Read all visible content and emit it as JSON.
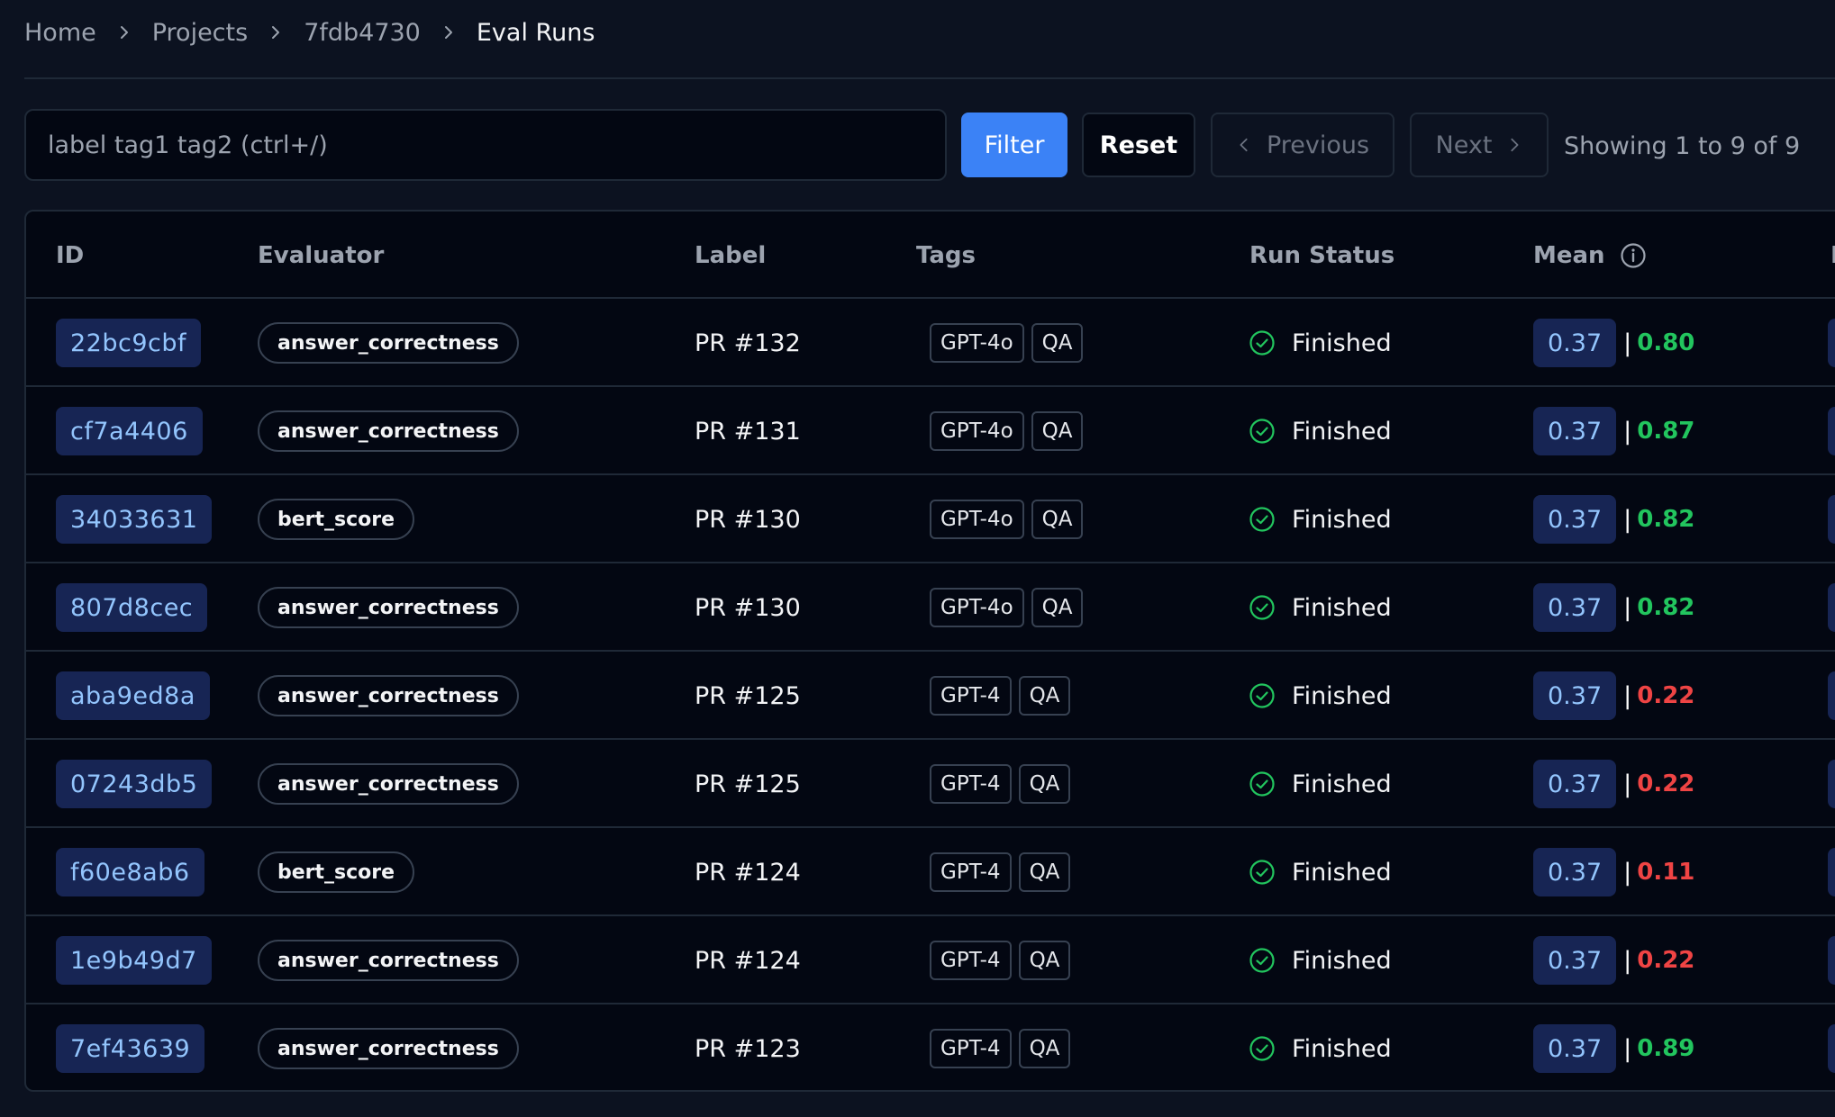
{
  "breadcrumb": {
    "items": [
      "Home",
      "Projects",
      "7fdb4730"
    ],
    "current": "Eval Runs"
  },
  "toolbar": {
    "search_placeholder": "label tag1 tag2 (ctrl+/)",
    "filter_label": "Filter",
    "reset_label": "Reset",
    "previous_label": "Previous",
    "next_label": "Next",
    "showing_text": "Showing 1 to 9 of 9"
  },
  "table": {
    "columns": {
      "id": "ID",
      "evaluator": "Evaluator",
      "label": "Label",
      "tags": "Tags",
      "run_status": "Run Status",
      "mean": "Mean",
      "next_partial": "P"
    },
    "rows": [
      {
        "id": "22bc9cbf",
        "evaluator": "answer_correctness",
        "label": "PR #132",
        "tags": [
          "GPT-4o",
          "QA"
        ],
        "status": "Finished",
        "mean": "0.37",
        "score": "0.80",
        "score_state": "good"
      },
      {
        "id": "cf7a4406",
        "evaluator": "answer_correctness",
        "label": "PR #131",
        "tags": [
          "GPT-4o",
          "QA"
        ],
        "status": "Finished",
        "mean": "0.37",
        "score": "0.87",
        "score_state": "good"
      },
      {
        "id": "34033631",
        "evaluator": "bert_score",
        "label": "PR #130",
        "tags": [
          "GPT-4o",
          "QA"
        ],
        "status": "Finished",
        "mean": "0.37",
        "score": "0.82",
        "score_state": "good"
      },
      {
        "id": "807d8cec",
        "evaluator": "answer_correctness",
        "label": "PR #130",
        "tags": [
          "GPT-4o",
          "QA"
        ],
        "status": "Finished",
        "mean": "0.37",
        "score": "0.82",
        "score_state": "good"
      },
      {
        "id": "aba9ed8a",
        "evaluator": "answer_correctness",
        "label": "PR #125",
        "tags": [
          "GPT-4",
          "QA"
        ],
        "status": "Finished",
        "mean": "0.37",
        "score": "0.22",
        "score_state": "bad"
      },
      {
        "id": "07243db5",
        "evaluator": "answer_correctness",
        "label": "PR #125",
        "tags": [
          "GPT-4",
          "QA"
        ],
        "status": "Finished",
        "mean": "0.37",
        "score": "0.22",
        "score_state": "bad"
      },
      {
        "id": "f60e8ab6",
        "evaluator": "bert_score",
        "label": "PR #124",
        "tags": [
          "GPT-4",
          "QA"
        ],
        "status": "Finished",
        "mean": "0.37",
        "score": "0.11",
        "score_state": "bad"
      },
      {
        "id": "1e9b49d7",
        "evaluator": "answer_correctness",
        "label": "PR #124",
        "tags": [
          "GPT-4",
          "QA"
        ],
        "status": "Finished",
        "mean": "0.37",
        "score": "0.22",
        "score_state": "bad"
      },
      {
        "id": "7ef43639",
        "evaluator": "answer_correctness",
        "label": "PR #123",
        "tags": [
          "GPT-4",
          "QA"
        ],
        "status": "Finished",
        "mean": "0.37",
        "score": "0.89",
        "score_state": "good"
      }
    ]
  },
  "colors": {
    "good": "#22c55e",
    "bad": "#ef4444",
    "status_ok": "#22c55e",
    "accent": "#3b82f6"
  },
  "icons": {
    "breadcrumb_separator": "chevron-right-icon",
    "previous": "chevron-left-icon",
    "next": "chevron-right-icon",
    "mean_info": "info-icon",
    "status": "check-circle-icon"
  }
}
